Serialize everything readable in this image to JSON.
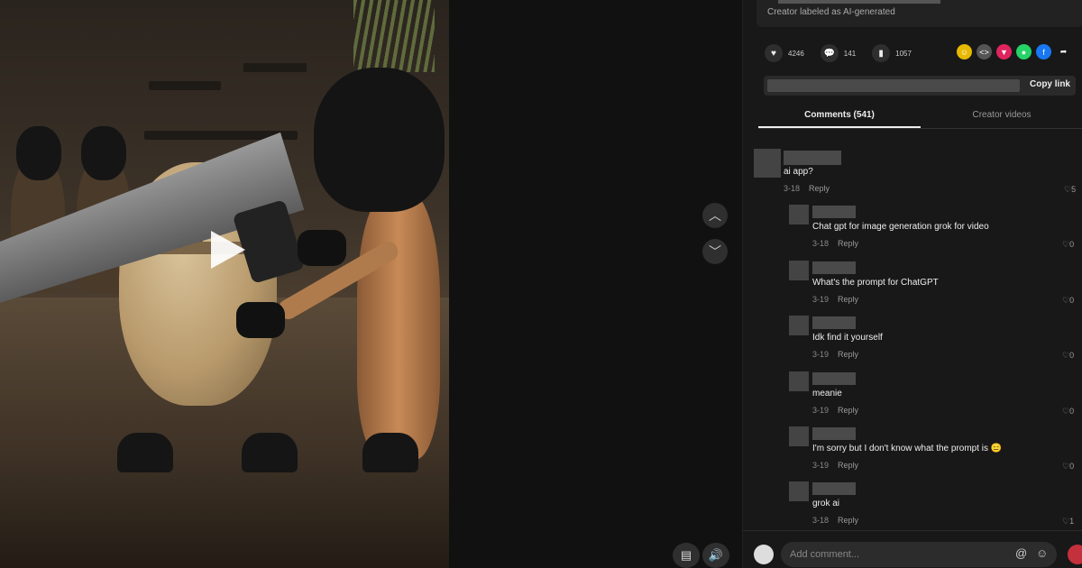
{
  "video": {
    "play_icon": "play-icon"
  },
  "navigation": {
    "prev_icon": "chevron-up-icon",
    "next_icon": "chevron-down-icon",
    "caption_icon": "captions-icon",
    "volume_icon": "volume-icon"
  },
  "panel": {
    "ai_label": "Creator labeled as AI-generated",
    "actions": {
      "likes": "4246",
      "comments": "141",
      "saves": "1057"
    },
    "share_icons": [
      "emoji-icon",
      "embed-icon",
      "pin-icon",
      "whatsapp-icon",
      "facebook-icon",
      "share-arrow-icon"
    ],
    "copy_link_label": "Copy link",
    "tabs": [
      {
        "label": "Comments (541)",
        "active": true
      },
      {
        "label": "Creator videos",
        "active": false
      }
    ],
    "comments": [
      {
        "text": "ai app?",
        "date": "3-18",
        "reply": "Reply",
        "likes": "5"
      },
      {
        "text": "Chat gpt for image generation grok for video",
        "date": "3-18",
        "reply": "Reply",
        "likes": "0"
      },
      {
        "text": "What's the prompt for ChatGPT",
        "date": "3-19",
        "reply": "Reply",
        "likes": "0"
      },
      {
        "text": "Idk find it yourself",
        "date": "3-19",
        "reply": "Reply",
        "likes": "0"
      },
      {
        "text": "meanie",
        "date": "3-19",
        "reply": "Reply",
        "likes": "0"
      },
      {
        "text": "I'm sorry but I don't know what the prompt is 😑",
        "date": "3-19",
        "reply": "Reply",
        "likes": "0"
      },
      {
        "text": "grok ai",
        "date": "3-18",
        "reply": "Reply",
        "likes": "1"
      }
    ],
    "comment_input": {
      "placeholder": "Add comment..."
    }
  },
  "colors": {
    "accent": "#c4303c",
    "background": "#181818"
  }
}
